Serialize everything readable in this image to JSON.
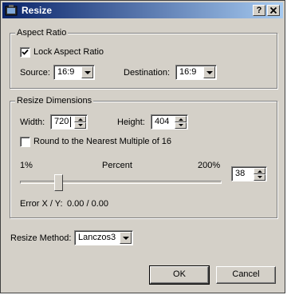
{
  "window": {
    "title": "Resize",
    "help_label": "?",
    "close_label": "X"
  },
  "aspect_ratio": {
    "group_title": "Aspect Ratio",
    "lock_label": "Lock Aspect Ratio",
    "lock_checked": true,
    "source_label": "Source:",
    "source_value": "16:9",
    "destination_label": "Destination:",
    "destination_value": "16:9"
  },
  "resize_dimensions": {
    "group_title": "Resize Dimensions",
    "width_label": "Width:",
    "width_value": "720",
    "height_label": "Height:",
    "height_value": "404",
    "round_label": "Round to the Nearest Multiple of 16",
    "round_checked": false,
    "slider_min_label": "1%",
    "slider_center_label": "Percent",
    "slider_max_label": "200%",
    "percent_value": "38",
    "error_label": "Error X / Y:",
    "error_value": "0.00 / 0.00"
  },
  "resize_method": {
    "label": "Resize Method:",
    "value": "Lanczos3"
  },
  "buttons": {
    "ok_label": "OK",
    "cancel_label": "Cancel"
  }
}
